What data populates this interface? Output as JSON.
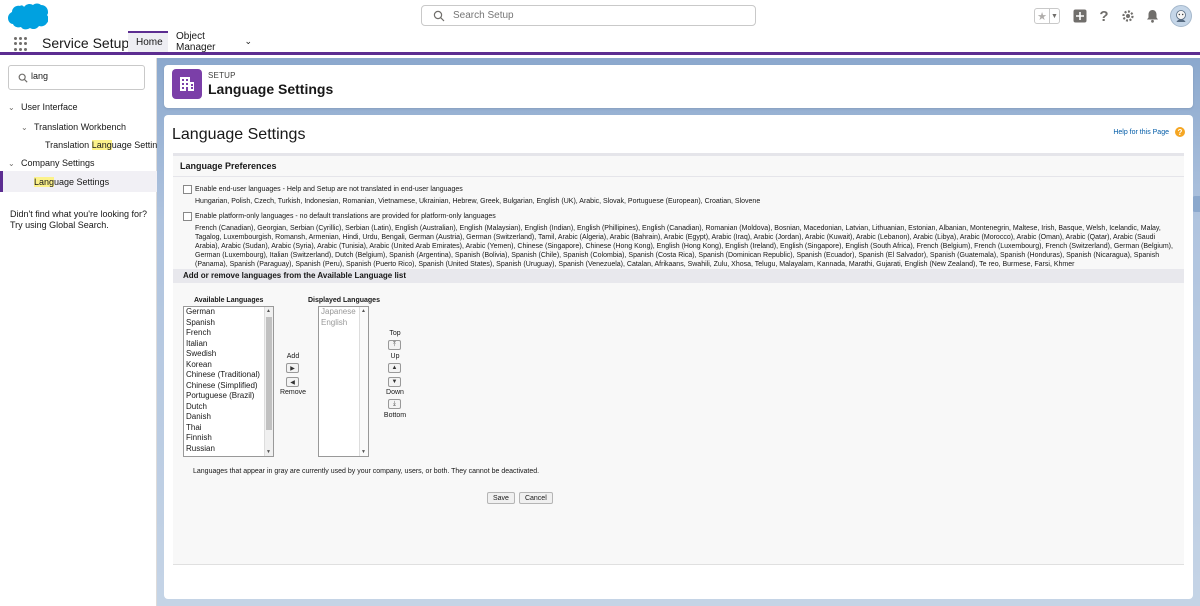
{
  "header": {
    "search_placeholder": "Search Setup",
    "icons": [
      "favorite-star-icon",
      "global-actions-plus-icon",
      "help-icon",
      "setup-gear-icon",
      "notifications-bell-icon",
      "avatar"
    ]
  },
  "context_nav": {
    "app_name": "Service Setup",
    "tabs": [
      {
        "label": "Home",
        "active": true
      },
      {
        "label": "Object Manager",
        "active": false
      }
    ]
  },
  "sidebar": {
    "quick_find_value": "lang",
    "tree": {
      "user_interface": "User Interface",
      "translation_workbench": "Translation Workbench",
      "translation_language_settings": {
        "pre": "Translation ",
        "match": "Lang",
        "post": "uage Settings"
      },
      "company_settings": "Company Settings",
      "language_settings": {
        "pre": "",
        "match": "Lang",
        "post": "uage Settings"
      }
    },
    "help_text": "Didn't find what you're looking for? Try using Global Search."
  },
  "page_header": {
    "eyebrow": "SETUP",
    "title": "Language Settings"
  },
  "content": {
    "title": "Language Settings",
    "help_link": "Help for this Page",
    "language_preferences_heading": "Language Preferences",
    "end_user_checkbox": {
      "label": "Enable end-user languages - Help and Setup are not translated in end-user languages",
      "checked": false,
      "languages": "Hungarian, Polish, Czech, Turkish, Indonesian, Romanian, Vietnamese, Ukrainian, Hebrew, Greek, Bulgarian, English (UK), Arabic, Slovak, Portuguese (European), Croatian, Slovene"
    },
    "platform_checkbox": {
      "label": "Enable platform-only languages - no default translations are provided for platform-only languages",
      "checked": false,
      "languages": "French (Canadian), Georgian, Serbian (Cyrillic), Serbian (Latin), English (Australian), English (Malaysian), English (Indian), English (Phillipines), English (Canadian), Romanian (Moldova), Bosnian, Macedonian, Latvian, Lithuanian, Estonian, Albanian, Montenegrin, Maltese, Irish, Basque, Welsh, Icelandic, Malay, Tagalog, Luxembourgish, Romansh, Armenian, Hindi, Urdu, Bengali, German (Austria), German (Switzerland), Tamil, Arabic (Algeria), Arabic (Bahrain), Arabic (Egypt), Arabic (Iraq), Arabic (Jordan), Arabic (Kuwait), Arabic (Lebanon), Arabic (Libya), Arabic (Morocco), Arabic (Oman), Arabic (Qatar), Arabic (Saudi Arabia), Arabic (Sudan), Arabic (Syria), Arabic (Tunisia), Arabic (United Arab Emirates), Arabic (Yemen), Chinese (Singapore), Chinese (Hong Kong), English (Hong Kong), English (Ireland), English (Singapore), English (South Africa), French (Belgium), French (Luxembourg), French (Switzerland), German (Belgium), German (Luxembourg), Italian (Switzerland), Dutch (Belgium), Spanish (Argentina), Spanish (Bolivia), Spanish (Chile), Spanish (Colombia), Spanish (Costa Rica), Spanish (Dominican Republic), Spanish (Ecuador), Spanish (El Salvador), Spanish (Guatemala), Spanish (Honduras), Spanish (Nicaragua), Spanish (Panama), Spanish (Paraguay), Spanish (Peru), Spanish (Puerto Rico), Spanish (United States), Spanish (Uruguay), Spanish (Venezuela), Catalan, Afrikaans, Swahili, Zulu, Xhosa, Telugu, Malayalam, Kannada, Marathi, Gujarati, English (New Zealand), Te reo, Burmese, Farsi, Khmer"
    },
    "add_remove_heading": "Add or remove languages from the Available Language list",
    "available_label": "Available Languages",
    "available": [
      "German",
      "Spanish",
      "French",
      "Italian",
      "Swedish",
      "Korean",
      "Chinese (Traditional)",
      "Chinese (Simplified)",
      "Portuguese (Brazil)",
      "Dutch",
      "Danish",
      "Thai",
      "Finnish",
      "Russian"
    ],
    "displayed_label": "Displayed Languages",
    "displayed": [
      "Japanese",
      "English"
    ],
    "add_label": "Add",
    "remove_label": "Remove",
    "top_label": "Top",
    "up_label": "Up",
    "down_label": "Down",
    "bottom_label": "Bottom",
    "note": "Languages that appear in gray are currently used by your company, users, or both. They cannot be deactivated.",
    "save_label": "Save",
    "cancel_label": "Cancel"
  }
}
